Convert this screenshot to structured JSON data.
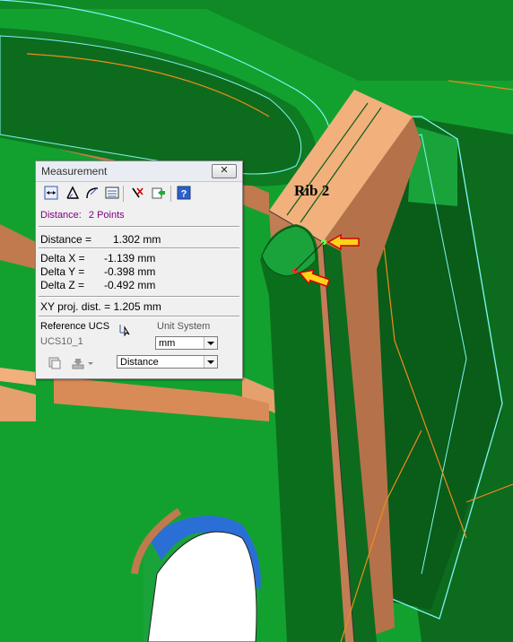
{
  "scene": {
    "label": "Rib 2"
  },
  "dialog": {
    "title": "Measurement",
    "close_label": "✕",
    "toolbar_icons": [
      "two-points-icon",
      "angle-icon",
      "radius-icon",
      "list-icon",
      "clear-icon",
      "export-icon",
      "help-icon"
    ],
    "mode_label": "Distance:",
    "mode_value": "2 Points",
    "distance_label": "Distance =",
    "distance_value": "1.302 mm",
    "delta_x_label": "Delta X =",
    "delta_x_value": "-1.139 mm",
    "delta_y_label": "Delta Y =",
    "delta_y_value": "-0.398 mm",
    "delta_z_label": "Delta Z =",
    "delta_z_value": "-0.492 mm",
    "xy_proj": "XY proj. dist. = 1.205 mm",
    "reference_ucs_label": "Reference UCS",
    "reference_ucs_value": "UCS10_1",
    "unit_system_label": "Unit System",
    "unit_value": "mm",
    "measure_type_value": "Distance"
  },
  "colors": {
    "green_dark": "#0a6a1c",
    "green": "#11a32e",
    "tan": "#e9a877",
    "brown": "#b5724a",
    "cyan": "#7ff5f2",
    "orange": "#f28a1c",
    "blue": "#2a6fd6"
  }
}
